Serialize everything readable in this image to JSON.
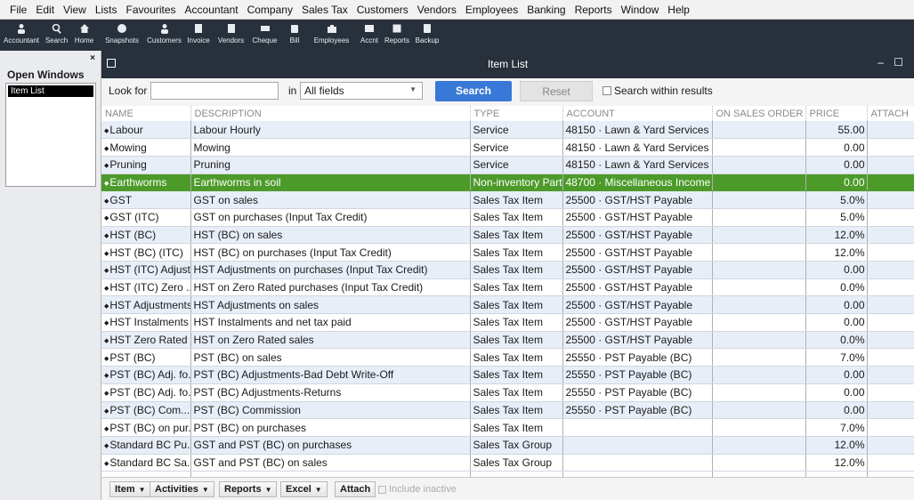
{
  "menu": [
    "File",
    "Edit",
    "View",
    "Lists",
    "Favourites",
    "Accountant",
    "Company",
    "Sales Tax",
    "Customers",
    "Vendors",
    "Employees",
    "Banking",
    "Reports",
    "Window",
    "Help"
  ],
  "iconbar": [
    {
      "label": "Accountant",
      "icon": "accountant-icon"
    },
    {
      "label": "Search",
      "icon": "search-icon"
    },
    {
      "label": "Home",
      "icon": "home-icon"
    },
    {
      "label": "Snapshots",
      "icon": "snapshots-icon"
    },
    {
      "label": "Customers",
      "icon": "customers-icon"
    },
    {
      "label": "Invoice",
      "icon": "invoice-icon"
    },
    {
      "label": "Vendors",
      "icon": "vendors-icon"
    },
    {
      "label": "Cheque",
      "icon": "cheque-icon"
    },
    {
      "label": "Bill",
      "icon": "bill-icon"
    },
    {
      "label": "Employees",
      "icon": "employees-icon"
    },
    {
      "label": "Accnt",
      "icon": "accnt-icon"
    },
    {
      "label": "Reports",
      "icon": "reports-icon"
    },
    {
      "label": "Backup",
      "icon": "backup-icon"
    }
  ],
  "open_windows": {
    "title": "Open Windows",
    "close": "×",
    "items": [
      "Item List"
    ]
  },
  "window": {
    "title": "Item List",
    "controls": "– ☐"
  },
  "search": {
    "look_for_label": "Look for",
    "look_for_value": "",
    "in_label": "in",
    "field_value": "All fields",
    "search_button": "Search",
    "reset_button": "Reset",
    "within_label": "Search within results"
  },
  "columns": [
    "NAME",
    "DESCRIPTION",
    "TYPE",
    "ACCOUNT",
    "ON SALES ORDER",
    "PRICE",
    "ATTACH"
  ],
  "rows": [
    {
      "name": "Labour",
      "description": "Labour Hourly",
      "type": "Service",
      "account": "48150 · Lawn & Yard Services",
      "on_sales_order": "",
      "price": "55.00"
    },
    {
      "name": "Mowing",
      "description": "Mowing",
      "type": "Service",
      "account": "48150 · Lawn & Yard Services",
      "on_sales_order": "",
      "price": "0.00"
    },
    {
      "name": "Pruning",
      "description": "Pruning",
      "type": "Service",
      "account": "48150 · Lawn & Yard Services",
      "on_sales_order": "",
      "price": "0.00"
    },
    {
      "name": "Earthworms",
      "description": "Earthworms in soil",
      "type": "Non-inventory Part",
      "account": "48700 · Miscellaneous Income",
      "on_sales_order": "",
      "price": "0.00",
      "selected": true
    },
    {
      "name": "GST",
      "description": "GST on sales",
      "type": "Sales Tax Item",
      "account": "25500 · GST/HST Payable",
      "on_sales_order": "",
      "price": "5.0%"
    },
    {
      "name": "GST (ITC)",
      "description": "GST on purchases (Input Tax Credit)",
      "type": "Sales Tax Item",
      "account": "25500 · GST/HST Payable",
      "on_sales_order": "",
      "price": "5.0%"
    },
    {
      "name": "HST (BC)",
      "description": "HST (BC) on sales",
      "type": "Sales Tax Item",
      "account": "25500 · GST/HST Payable",
      "on_sales_order": "",
      "price": "12.0%"
    },
    {
      "name": "HST (BC) (ITC)",
      "description": "HST (BC) on purchases (Input Tax Credit)",
      "type": "Sales Tax Item",
      "account": "25500 · GST/HST Payable",
      "on_sales_order": "",
      "price": "12.0%"
    },
    {
      "name": "HST (ITC) Adjust...",
      "description": "HST Adjustments on purchases (Input Tax Credit)",
      "type": "Sales Tax Item",
      "account": "25500 · GST/HST Payable",
      "on_sales_order": "",
      "price": "0.00"
    },
    {
      "name": "HST (ITC) Zero ...",
      "description": "HST on Zero Rated purchases (Input Tax Credit)",
      "type": "Sales Tax Item",
      "account": "25500 · GST/HST Payable",
      "on_sales_order": "",
      "price": "0.0%"
    },
    {
      "name": "HST Adjustments",
      "description": "HST Adjustments on sales",
      "type": "Sales Tax Item",
      "account": "25500 · GST/HST Payable",
      "on_sales_order": "",
      "price": "0.00"
    },
    {
      "name": "HST Instalments",
      "description": "HST Instalments and net tax paid",
      "type": "Sales Tax Item",
      "account": "25500 · GST/HST Payable",
      "on_sales_order": "",
      "price": "0.00"
    },
    {
      "name": "HST Zero Rated",
      "description": "HST on Zero Rated sales",
      "type": "Sales Tax Item",
      "account": "25500 · GST/HST Payable",
      "on_sales_order": "",
      "price": "0.0%"
    },
    {
      "name": "PST (BC)",
      "description": "PST (BC) on sales",
      "type": "Sales Tax Item",
      "account": "25550 · PST Payable (BC)",
      "on_sales_order": "",
      "price": "7.0%"
    },
    {
      "name": "PST (BC) Adj. fo...",
      "description": "PST (BC) Adjustments-Bad Debt Write-Off",
      "type": "Sales Tax Item",
      "account": "25550 · PST Payable (BC)",
      "on_sales_order": "",
      "price": "0.00"
    },
    {
      "name": "PST (BC) Adj. fo...",
      "description": "PST (BC) Adjustments-Returns",
      "type": "Sales Tax Item",
      "account": "25550 · PST Payable (BC)",
      "on_sales_order": "",
      "price": "0.00"
    },
    {
      "name": "PST (BC) Com...",
      "description": "PST (BC) Commission",
      "type": "Sales Tax Item",
      "account": "25550 · PST Payable (BC)",
      "on_sales_order": "",
      "price": "0.00"
    },
    {
      "name": "PST (BC) on pur...",
      "description": "PST (BC) on purchases",
      "type": "Sales Tax Item",
      "account": "",
      "on_sales_order": "",
      "price": "7.0%"
    },
    {
      "name": "Standard BC Pu...",
      "description": "GST and PST (BC) on purchases",
      "type": "Sales Tax Group",
      "account": "",
      "on_sales_order": "",
      "price": "12.0%"
    },
    {
      "name": "Standard BC Sa...",
      "description": "GST and PST (BC) on sales",
      "type": "Sales Tax Group",
      "account": "",
      "on_sales_order": "",
      "price": "12.0%"
    }
  ],
  "bottom": {
    "item_button": "Item",
    "activities_button": "Activities",
    "reports_button": "Reports",
    "excel_button": "Excel",
    "attach_button": "Attach",
    "include_inactive": "Include inactive"
  },
  "colors": {
    "selected_row": "#4c9a2a",
    "search_button": "#3878d6",
    "chrome_dark": "#27303b"
  }
}
